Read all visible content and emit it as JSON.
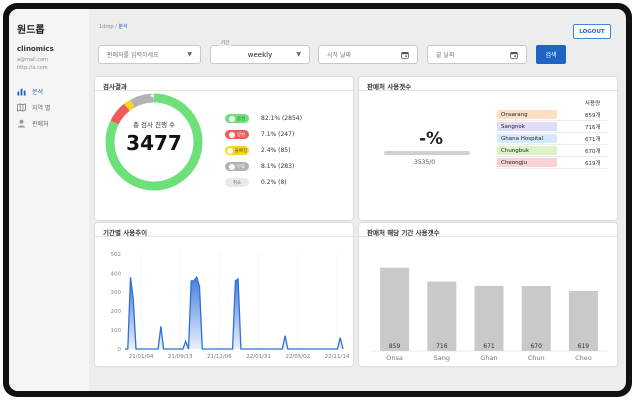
{
  "sidebar": {
    "brand": "원드롭",
    "org_name": "clinomics",
    "email": "a@mail.com",
    "website": "http://a.com",
    "items": [
      {
        "label": "분석",
        "icon": "bar-chart-icon",
        "active": true
      },
      {
        "label": "지역 별",
        "icon": "map-icon",
        "active": false
      },
      {
        "label": "판매처",
        "icon": "person-icon",
        "active": false
      }
    ]
  },
  "header": {
    "breadcrumb_root": "1drop",
    "breadcrumb_sep": "/",
    "breadcrumb_current": "분석",
    "logout_label": "LOGOUT"
  },
  "filters": {
    "seller_placeholder": "판매처를 입력하세요",
    "period_label": "기간",
    "period_value": "weekly",
    "start_placeholder": "시작 날짜",
    "end_placeholder": "끝 날짜",
    "search_label": "검색"
  },
  "test_results": {
    "title": "검사결과",
    "center_label": "총 검사 진행 수",
    "center_value": "3477",
    "items": [
      {
        "label": "음성",
        "value": "82.1% (2854)",
        "color": "#6ee07a",
        "fraction": 0.821
      },
      {
        "label": "양성",
        "value": "7.1% (247)",
        "color": "#f05a5a",
        "fraction": 0.071
      },
      {
        "label": "불확정",
        "value": "2.4% (85)",
        "color": "#f5d623",
        "fraction": 0.024
      },
      {
        "label": "무효",
        "value": "8.1% (283)",
        "color": "#b3b3b3",
        "fraction": 0.081
      },
      {
        "label": "취소",
        "value": "0.2% (8)",
        "color": "#e9e9e9",
        "fraction": 0.002
      }
    ]
  },
  "seller_usage": {
    "title": "판매처 사용갯수",
    "percent": "-%",
    "ratio": "3535/0",
    "column_header": "사용량",
    "rows": [
      {
        "name": "Onsarang",
        "count": "859개",
        "color": "#fbe0c8"
      },
      {
        "name": "Sangnok",
        "count": "716개",
        "color": "#e0dcf5"
      },
      {
        "name": "Ghana Hospital",
        "count": "671개",
        "color": "#d6e8fb"
      },
      {
        "name": "Chungbuk",
        "count": "670개",
        "color": "#dff3c9"
      },
      {
        "name": "Cheongju",
        "count": "619개",
        "color": "#f9d3d6"
      }
    ]
  },
  "period_usage": {
    "title": "기간별 사용추이",
    "chart_data": {
      "type": "area",
      "x_ticks": [
        "21/01/04",
        "21/09/13",
        "21/12/06",
        "22/01/31",
        "22/05/02",
        "22/11/14"
      ],
      "y_ticks": [
        "502",
        "400",
        "300",
        "200",
        "100",
        "0"
      ],
      "ylim": [
        0,
        502
      ],
      "values": [
        0,
        0,
        380,
        260,
        0,
        0,
        0,
        0,
        0,
        0,
        0,
        0,
        0,
        120,
        0,
        0,
        0,
        0,
        0,
        0,
        0,
        0,
        40,
        0,
        360,
        360,
        380,
        330,
        0,
        0,
        0,
        0,
        0,
        0,
        0,
        0,
        0,
        0,
        0,
        0,
        360,
        370,
        0,
        0,
        0,
        0,
        0,
        0,
        0,
        0,
        0,
        0,
        0,
        0,
        0,
        0,
        0,
        0,
        70,
        0,
        0,
        0,
        0,
        0,
        0,
        0,
        0,
        0,
        0,
        0,
        0,
        0,
        0,
        0,
        0,
        0,
        0,
        0,
        60,
        0
      ],
      "color": "#2e6fd8"
    }
  },
  "seller_period_usage": {
    "title": "판매처 해당 기간 사용갯수",
    "chart_data": {
      "type": "bar",
      "categories": [
        "Onsa",
        "Sang",
        "Ghan",
        "Chun",
        "Cheo"
      ],
      "values": [
        859,
        716,
        671,
        670,
        619
      ],
      "ylim": [
        0,
        1000
      ],
      "color": "#c9c9c9"
    }
  }
}
